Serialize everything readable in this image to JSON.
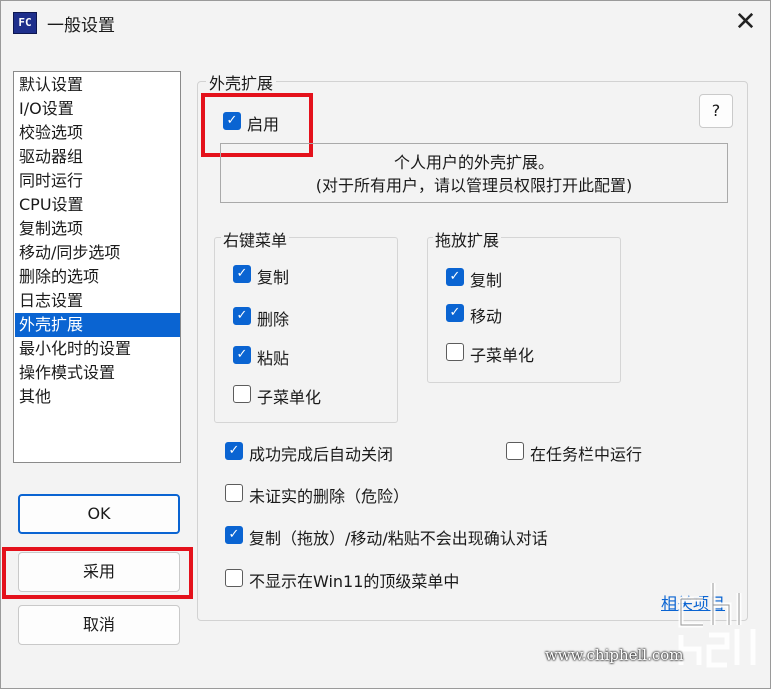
{
  "window": {
    "title": "一般设置",
    "app_icon_text": "FC",
    "close_glyph": "✕"
  },
  "nav": {
    "items": [
      "默认设置",
      "I/O设置",
      "校验选项",
      "驱动器组",
      "同时运行",
      "CPU设置",
      "复制选项",
      "移动/同步选项",
      "删除的选项",
      "日志设置",
      "外壳扩展",
      "最小化时的设置",
      "操作模式设置",
      "其他"
    ],
    "selected": "外壳扩展"
  },
  "buttons": {
    "ok": "OK",
    "apply": "采用",
    "cancel": "取消"
  },
  "panel": {
    "title": "外壳扩展",
    "enable": {
      "label": "启用",
      "checked": true
    },
    "help_label": "?",
    "description": [
      "个人用户的外壳扩展。",
      "(对于所有用户，请以管理员权限打开此配置)"
    ]
  },
  "context_menu": {
    "title": "右键菜单",
    "items": [
      {
        "label": "复制",
        "checked": true
      },
      {
        "label": "删除",
        "checked": true
      },
      {
        "label": "粘贴",
        "checked": true
      },
      {
        "label": "子菜单化",
        "checked": false
      }
    ]
  },
  "drag_drop": {
    "title": "拖放扩展",
    "items": [
      {
        "label": "复制",
        "checked": true
      },
      {
        "label": "移动",
        "checked": true
      },
      {
        "label": "子菜单化",
        "checked": false
      }
    ]
  },
  "options": [
    {
      "label": "成功完成后自动关闭",
      "checked": true
    },
    {
      "label": "在任务栏中运行",
      "checked": false
    },
    {
      "label": "未证实的删除（危险）",
      "checked": false
    },
    {
      "label": "复制（拖放）/移动/粘贴不会出现确认对话",
      "checked": true
    },
    {
      "label": "不显示在Win11的顶级菜单中",
      "checked": false
    }
  ],
  "related_link": "相关项目",
  "watermark": {
    "text": "www.chiphell.com",
    "logo_text": "chip hell"
  },
  "colors": {
    "accent": "#0a64d2",
    "highlight_box": "#e4111b",
    "window_bg": "#f3f3f3"
  }
}
